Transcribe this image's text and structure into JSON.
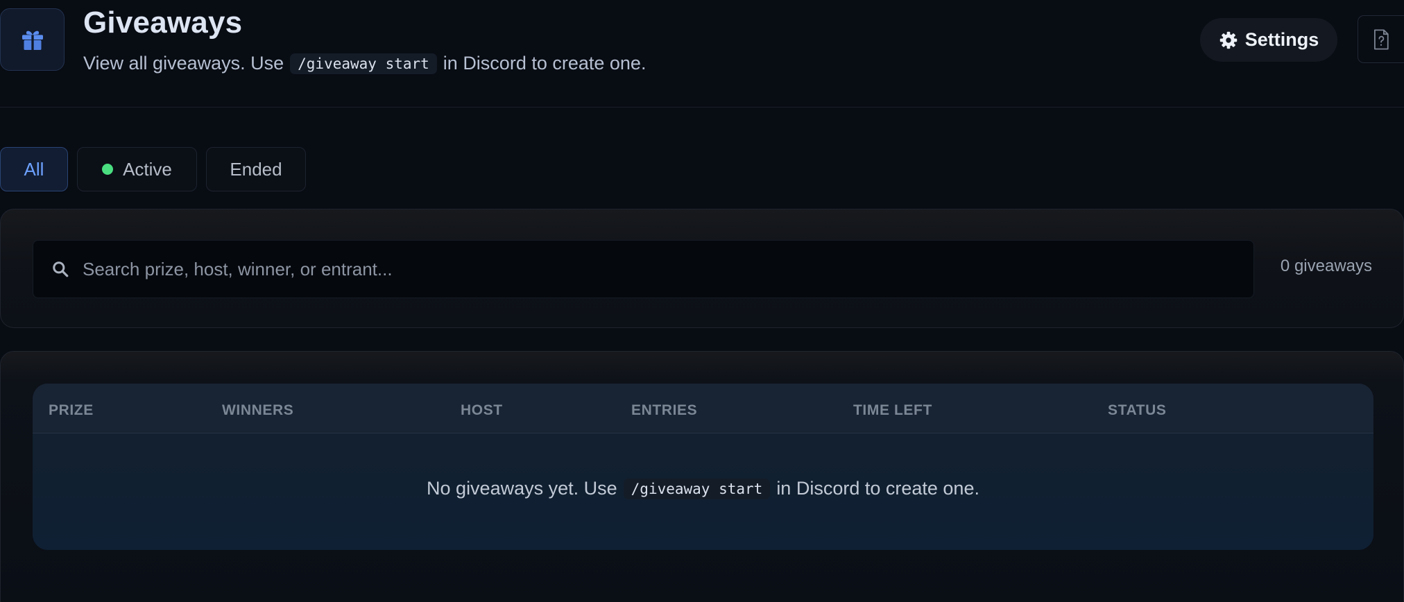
{
  "header": {
    "icon": "gift-icon",
    "title": "Giveaways",
    "subtitle_before": "View all giveaways. Use",
    "subtitle_code": "/giveaway start",
    "subtitle_after": "in Discord to create one.",
    "settings_label": "Settings",
    "settings_icon": "gear-icon",
    "help_icon": "document-help-icon"
  },
  "filters": {
    "tabs": [
      {
        "label": "All",
        "selected": true
      },
      {
        "label": "Active",
        "indicator_color": "#4ade80"
      },
      {
        "label": "Ended"
      }
    ]
  },
  "search": {
    "placeholder": "Search prize, host, winner, or entrant...",
    "value": "",
    "count_label": "0 giveaways"
  },
  "table": {
    "columns": [
      "PRIZE",
      "WINNERS",
      "HOST",
      "ENTRIES",
      "TIME LEFT",
      "STATUS"
    ],
    "rows": [],
    "empty": {
      "before": "No giveaways yet. Use",
      "code": "/giveaway start",
      "after": "in Discord to create one."
    }
  },
  "colors": {
    "background": "#080c13",
    "accent": "#6da1ff",
    "active_green": "#4ade80"
  }
}
